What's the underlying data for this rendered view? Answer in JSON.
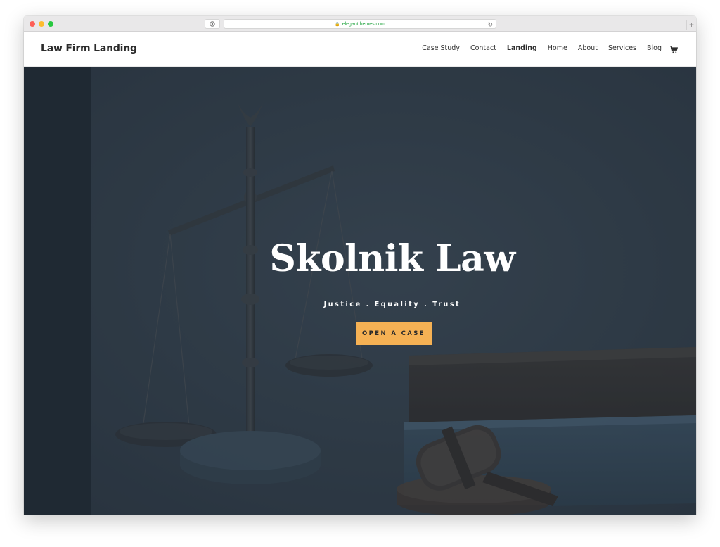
{
  "browser": {
    "url": "elegantthemes.com",
    "icons": [
      "lock-icon",
      "reader-icon",
      "reload-icon",
      "new-tab-icon"
    ]
  },
  "site": {
    "logo": "Law Firm Landing",
    "nav": [
      {
        "label": "Case Study"
      },
      {
        "label": "Contact"
      },
      {
        "label": "Landing",
        "active": true
      },
      {
        "label": "Home"
      },
      {
        "label": "About"
      },
      {
        "label": "Services"
      },
      {
        "label": "Blog"
      }
    ],
    "cart_icon": "cart-icon"
  },
  "hero": {
    "title": "Skolnik Law",
    "tagline": "Justice . Equality . Trust",
    "cta_label": "OPEN A CASE",
    "background_image": "scales-of-justice-gavel-books",
    "colors": {
      "overlay": "#303c48",
      "cta": "#f5b154"
    }
  }
}
